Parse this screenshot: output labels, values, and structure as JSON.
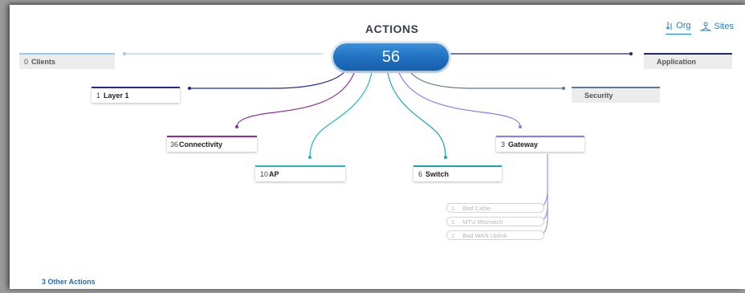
{
  "title": "ACTIONS",
  "total": "56",
  "view_switch": {
    "org_label": "Org",
    "sites_label": "Sites"
  },
  "categories": {
    "clients": {
      "count": "0",
      "label": "Clients"
    },
    "application": {
      "count": "",
      "label": "Application"
    },
    "layer1": {
      "count": "1",
      "label": "Layer 1"
    },
    "security": {
      "count": "",
      "label": "Security"
    },
    "connectivity": {
      "count": "36",
      "label": "Connectivity"
    },
    "gateway": {
      "count": "3",
      "label": "Gateway"
    },
    "ap": {
      "count": "10",
      "label": "AP"
    },
    "switch": {
      "count": "6",
      "label": "Switch"
    }
  },
  "gateway_actions": [
    {
      "count": "1",
      "label": "Bad Cable"
    },
    {
      "count": "1",
      "label": "MTU Mismatch"
    },
    {
      "count": "1",
      "label": "Bad WAN Uplink"
    }
  ],
  "other_actions": "3 Other Actions",
  "colors": {
    "clients": "#9cc8ec",
    "application": "#1f2a6b",
    "layer1": "#1f2a8c",
    "security": "#5b7894",
    "connectivity": "#8a2f9a",
    "gateway": "#8a7cf0",
    "ap": "#27b3c0",
    "switch": "#1aa3b3",
    "hub": "#1f6fc0"
  }
}
